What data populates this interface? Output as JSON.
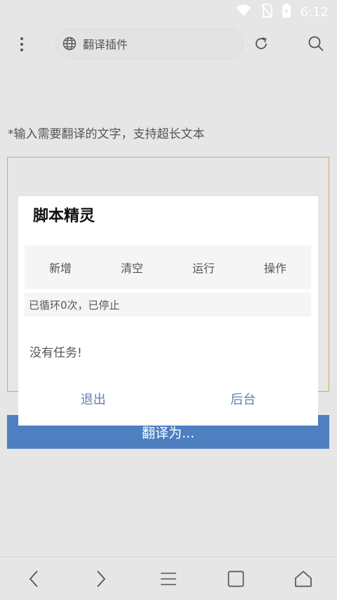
{
  "status_bar": {
    "time": "6:12",
    "icons": [
      "wifi-icon",
      "no-sim-icon",
      "battery-charging-icon"
    ]
  },
  "toolbar": {
    "menu_icon": "more-vertical-icon",
    "url_icon": "globe-icon",
    "url_text": "翻译插件",
    "reload_icon": "refresh-icon",
    "search_icon": "search-icon"
  },
  "page": {
    "hint": "*输入需要翻译的文字，支持超长文本",
    "translate_button": "翻译为..."
  },
  "modal": {
    "title": "脚本精灵",
    "tabs": [
      {
        "label": "新增"
      },
      {
        "label": "清空"
      },
      {
        "label": "运行"
      },
      {
        "label": "操作"
      }
    ],
    "status": "已循环0次，已停止",
    "empty_message": "没有任务!",
    "actions": [
      {
        "label": "退出"
      },
      {
        "label": "后台"
      }
    ]
  },
  "nav_bar": {
    "items": [
      "back-icon",
      "forward-icon",
      "menu-icon",
      "tabs-icon",
      "home-icon"
    ]
  },
  "colors": {
    "accent": "#4d7fc1",
    "input_border": "#d3aa55",
    "modal_action": "#5f7fb2",
    "background": "#e6e6e6"
  }
}
